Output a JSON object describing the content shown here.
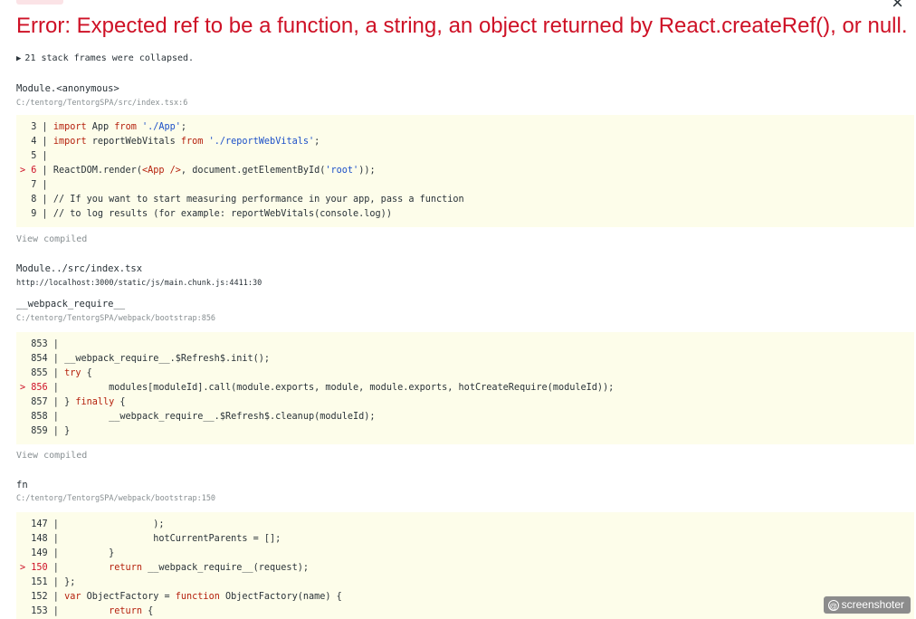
{
  "overlay": {
    "close_label": "×",
    "error_title": "Error: Expected ref to be a function, a string, an object returned by React.createRef(), or null.",
    "collapsed_label": "21 stack frames were collapsed.",
    "view_compiled_label": "View compiled"
  },
  "frames": [
    {
      "name": "Module.<anonymous>",
      "path": "C:/tentorg/TentorgSPA/src/index.tsx:6",
      "code": [
        {
          "n": "3",
          "marker": " ",
          "text": "import App from './App';"
        },
        {
          "n": "4",
          "marker": " ",
          "text": "import reportWebVitals from './reportWebVitals';"
        },
        {
          "n": "5",
          "marker": " ",
          "text": ""
        },
        {
          "n": "6",
          "marker": ">",
          "text": "ReactDOM.render(<App />, document.getElementById('root'));"
        },
        {
          "n": "7",
          "marker": " ",
          "text": ""
        },
        {
          "n": "8",
          "marker": " ",
          "text": "// If you want to start measuring performance in your app, pass a function"
        },
        {
          "n": "9",
          "marker": " ",
          "text": "// to log results (for example: reportWebVitals(console.log))"
        }
      ]
    },
    {
      "name": "Module../src/index.tsx",
      "path": "http://localhost:3000/static/js/main.chunk.js:4411:30"
    },
    {
      "name": "__webpack_require__",
      "path": "C:/tentorg/TentorgSPA/webpack/bootstrap:856",
      "code": [
        {
          "n": "853",
          "marker": " ",
          "text": ""
        },
        {
          "n": "854",
          "marker": " ",
          "text": "__webpack_require__.$Refresh$.init();"
        },
        {
          "n": "855",
          "marker": " ",
          "text": "try {"
        },
        {
          "n": "856",
          "marker": ">",
          "text": "        modules[moduleId].call(module.exports, module, module.exports, hotCreateRequire(moduleId));"
        },
        {
          "n": "857",
          "marker": " ",
          "text": "} finally {"
        },
        {
          "n": "858",
          "marker": " ",
          "text": "        __webpack_require__.$Refresh$.cleanup(moduleId);"
        },
        {
          "n": "859",
          "marker": " ",
          "text": "}"
        }
      ]
    },
    {
      "name": "fn",
      "path": "C:/tentorg/TentorgSPA/webpack/bootstrap:150",
      "code": [
        {
          "n": "147",
          "marker": " ",
          "text": "                );"
        },
        {
          "n": "148",
          "marker": " ",
          "text": "                hotCurrentParents = [];"
        },
        {
          "n": "149",
          "marker": " ",
          "text": "        }"
        },
        {
          "n": "150",
          "marker": ">",
          "text": "        return __webpack_require__(request);"
        },
        {
          "n": "151",
          "marker": " ",
          "text": "};"
        },
        {
          "n": "152",
          "marker": " ",
          "text": "var ObjectFactory = function ObjectFactory(name) {"
        },
        {
          "n": "153",
          "marker": " ",
          "text": "        return {"
        }
      ]
    }
  ],
  "watermark": {
    "icon": "at-icon",
    "label": "screenshoter"
  },
  "colors": {
    "error_red": "#ce1126",
    "code_background": "#fdfdea",
    "muted_gray": "#878e91"
  }
}
